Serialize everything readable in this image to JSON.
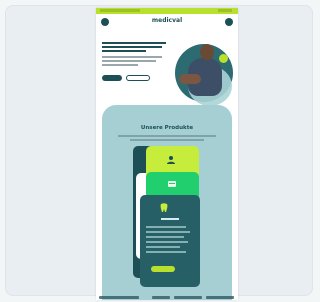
{
  "page": {
    "brand": "medicval",
    "section_title": "Unsere Produkte"
  },
  "colors": {
    "accent_lime": "#b9e02d",
    "accent_green": "#22cf6e",
    "brand_dark": "#1d4f57",
    "panel_teal": "#a6cfd4"
  },
  "icons": {
    "menu": "menu-icon",
    "profile": "profile-icon",
    "product_1": "family-icon",
    "product_2": "document-icon",
    "product_3": "tooth-icon"
  }
}
